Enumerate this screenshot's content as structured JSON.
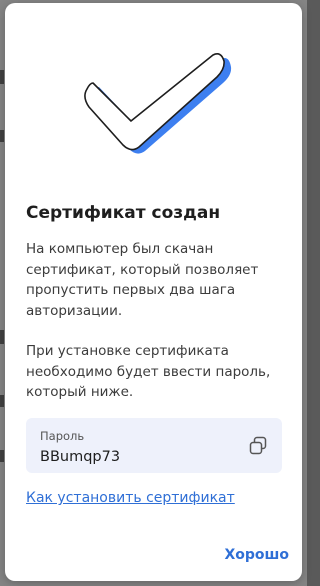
{
  "dialog": {
    "title": "Сертификат создан",
    "paragraph_1": "На компьютер был скачан сертификат, который позволяет пропустить первых два шага авторизации.",
    "paragraph_2": "При установке сертификата необходимо будет ввести пароль, который ниже.",
    "password_label": "Пароль",
    "password_value": "BBumqp73",
    "help_link": "Как установить сертификат",
    "ok_button": "Хорошо"
  },
  "colors": {
    "accent": "#2f6fd6",
    "checkmark_shadow": "#3d7ff0",
    "password_box_bg": "#eef1fb"
  },
  "icons": {
    "illustration": "checkmark-icon",
    "copy": "copy-icon"
  }
}
